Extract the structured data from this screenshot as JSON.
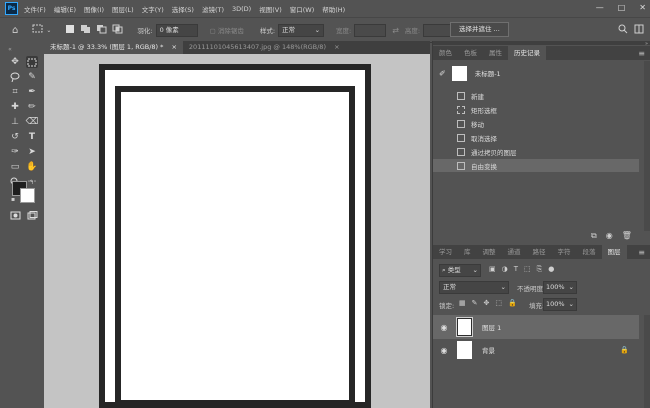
{
  "app": {
    "logo_text": "Ps"
  },
  "menu": [
    "文件(F)",
    "编辑(E)",
    "图像(I)",
    "图层(L)",
    "文字(Y)",
    "选择(S)",
    "滤镜(T)",
    "3D(D)",
    "视图(V)",
    "窗口(W)",
    "帮助(H)"
  ],
  "window_controls": {
    "minimize": "—",
    "maximize": "□",
    "close": "✕"
  },
  "options_bar": {
    "feather_label": "羽化:",
    "feather_value": "0 像素",
    "antialias_label": "消除锯齿",
    "style_label": "样式:",
    "style_value": "正常",
    "width_label": "宽度:",
    "height_label": "高度:",
    "select_mask_button": "选择并遮住 ..."
  },
  "tabs": [
    {
      "label": "未标题-1 @ 33.3% (图层 1, RGB/8) *",
      "close": "×",
      "active": true
    },
    {
      "label": "20111101045613407.jpg @ 148%(RGB/8)",
      "close": "×",
      "active": false
    }
  ],
  "history_panel": {
    "tabs": [
      "颜色",
      "色板",
      "属性",
      "历史记录"
    ],
    "active_tab": "历史记录",
    "snapshot_label": "未标题-1",
    "states": [
      "新建",
      "矩形选框",
      "移动",
      "取消选择",
      "通过拷贝的图层",
      "自由变换"
    ],
    "selected_state": 5
  },
  "layers_panel": {
    "tabs": [
      "学习",
      "库",
      "调整",
      "通道",
      "路径",
      "字符",
      "段落",
      "图层"
    ],
    "active_tab": "图层",
    "filter_kind": "类型",
    "blend_mode": "正常",
    "opacity_label": "不透明度:",
    "opacity_value": "100%",
    "lock_label": "锁定:",
    "fill_label": "填充:",
    "fill_value": "100%",
    "layers": [
      {
        "name": "图层 1",
        "selected": true,
        "locked": false
      },
      {
        "name": "背景",
        "selected": false,
        "locked": true
      }
    ]
  },
  "colors": {
    "foreground": "#1e1e1e",
    "background": "#ffffff",
    "accent": "#31a8ff"
  }
}
